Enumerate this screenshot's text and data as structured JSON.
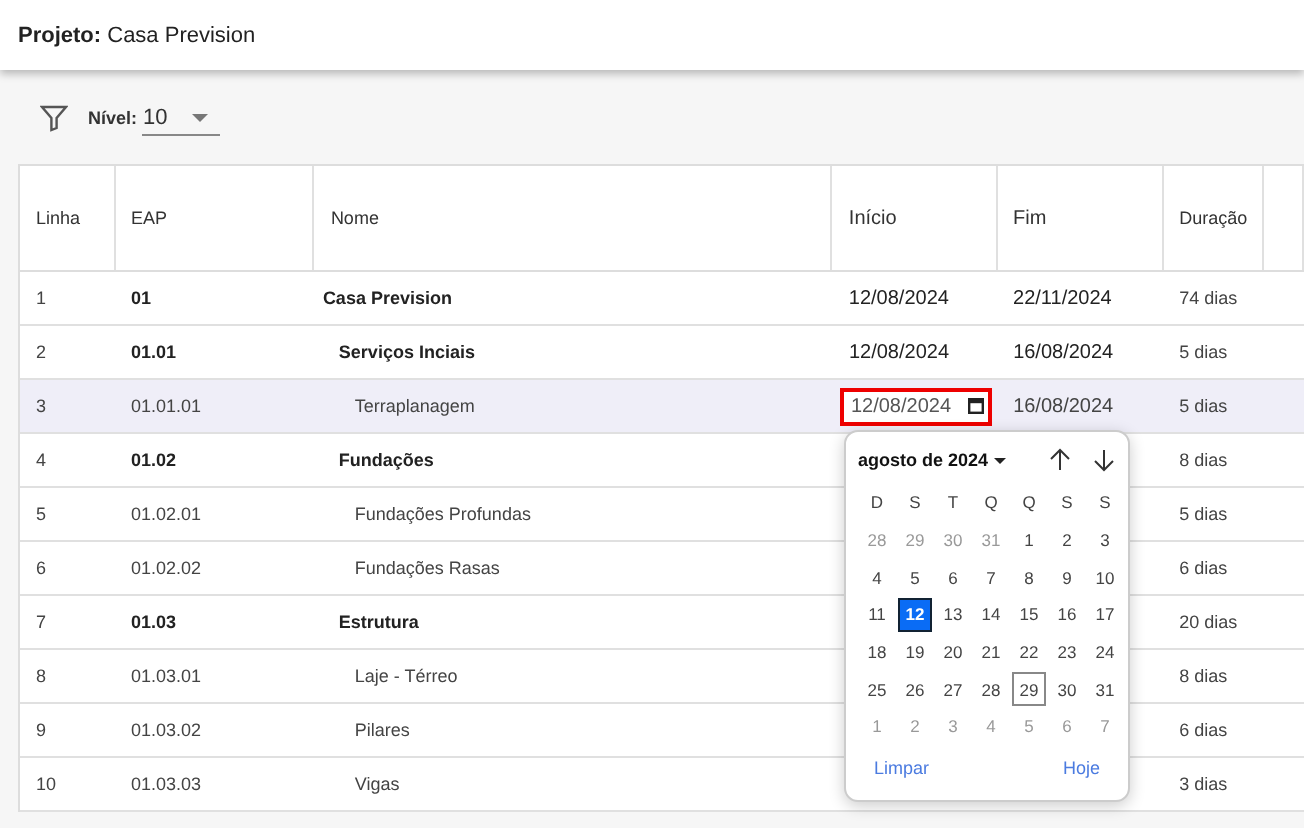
{
  "header": {
    "label": "Projeto:",
    "value": "Casa Prevision"
  },
  "toolbar": {
    "level_label": "Nível:",
    "level_value": "10"
  },
  "table": {
    "columns": [
      "Linha",
      "EAP",
      "Nome",
      "Início",
      "Fim",
      "Duração"
    ],
    "rows": [
      {
        "line": "1",
        "eap": "01",
        "name": "Casa Prevision",
        "start": "12/08/2024",
        "end": "22/11/2024",
        "duration": "74 dias",
        "selected": false,
        "editing": false,
        "children": [
          {
            "line": "2",
            "eap": "01.01",
            "name": "Serviços Inciais",
            "start": "12/08/2024",
            "end": "16/08/2024",
            "duration": "5 dias",
            "selected": false,
            "editing": false,
            "children": [
              {
                "line": "3",
                "eap": "01.01.01",
                "name": "Terraplanagem",
                "start": "12/08/2024",
                "end": "16/08/2024",
                "duration": "5 dias",
                "selected": true,
                "editing": true
              }
            ]
          },
          {
            "line": "4",
            "eap": "01.02",
            "name": "Fundações",
            "duration": "8 dias",
            "selected": false,
            "editing": false,
            "children": [
              {
                "line": "5",
                "eap": "01.02.01",
                "name": "Fundações Profundas",
                "duration": "5 dias",
                "selected": false,
                "editing": false
              },
              {
                "line": "6",
                "eap": "01.02.02",
                "name": "Fundações Rasas",
                "duration": "6 dias",
                "selected": false,
                "editing": false
              }
            ]
          },
          {
            "line": "7",
            "eap": "01.03",
            "name": "Estrutura",
            "duration": "20 dias",
            "selected": false,
            "editing": false,
            "children": [
              {
                "line": "8",
                "eap": "01.03.01",
                "name": "Laje - Térreo",
                "duration": "8 dias",
                "selected": false,
                "editing": false
              },
              {
                "line": "9",
                "eap": "01.03.02",
                "name": "Pilares",
                "duration": "6 dias",
                "selected": false,
                "editing": false
              },
              {
                "line": "10",
                "eap": "01.03.03",
                "name": "Vigas",
                "duration": "3 dias",
                "selected": false,
                "editing": false
              }
            ]
          }
        ]
      }
    ]
  },
  "calendar": {
    "month": "agosto de 2024",
    "weekdays": [
      "D",
      "S",
      "T",
      "Q",
      "Q",
      "S",
      "S"
    ],
    "days": [
      {
        "label": "28",
        "in_month": false,
        "selected": false,
        "today": false
      },
      {
        "label": "29",
        "in_month": false,
        "selected": false,
        "today": false
      },
      {
        "label": "30",
        "in_month": false,
        "selected": false,
        "today": false
      },
      {
        "label": "31",
        "in_month": false,
        "selected": false,
        "today": false
      },
      {
        "label": "1",
        "in_month": true,
        "selected": false,
        "today": false
      },
      {
        "label": "2",
        "in_month": true,
        "selected": false,
        "today": false
      },
      {
        "label": "3",
        "in_month": true,
        "selected": false,
        "today": false
      },
      {
        "label": "4",
        "in_month": true,
        "selected": false,
        "today": false
      },
      {
        "label": "5",
        "in_month": true,
        "selected": false,
        "today": false
      },
      {
        "label": "6",
        "in_month": true,
        "selected": false,
        "today": false
      },
      {
        "label": "7",
        "in_month": true,
        "selected": false,
        "today": false
      },
      {
        "label": "8",
        "in_month": true,
        "selected": false,
        "today": false
      },
      {
        "label": "9",
        "in_month": true,
        "selected": false,
        "today": false
      },
      {
        "label": "10",
        "in_month": true,
        "selected": false,
        "today": false
      },
      {
        "label": "11",
        "in_month": true,
        "selected": false,
        "today": false
      },
      {
        "label": "12",
        "in_month": true,
        "selected": true,
        "today": false
      },
      {
        "label": "13",
        "in_month": true,
        "selected": false,
        "today": false
      },
      {
        "label": "14",
        "in_month": true,
        "selected": false,
        "today": false
      },
      {
        "label": "15",
        "in_month": true,
        "selected": false,
        "today": false
      },
      {
        "label": "16",
        "in_month": true,
        "selected": false,
        "today": false
      },
      {
        "label": "17",
        "in_month": true,
        "selected": false,
        "today": false
      },
      {
        "label": "18",
        "in_month": true,
        "selected": false,
        "today": false
      },
      {
        "label": "19",
        "in_month": true,
        "selected": false,
        "today": false
      },
      {
        "label": "20",
        "in_month": true,
        "selected": false,
        "today": false
      },
      {
        "label": "21",
        "in_month": true,
        "selected": false,
        "today": false
      },
      {
        "label": "22",
        "in_month": true,
        "selected": false,
        "today": false
      },
      {
        "label": "23",
        "in_month": true,
        "selected": false,
        "today": false
      },
      {
        "label": "24",
        "in_month": true,
        "selected": false,
        "today": false
      },
      {
        "label": "25",
        "in_month": true,
        "selected": false,
        "today": false
      },
      {
        "label": "26",
        "in_month": true,
        "selected": false,
        "today": false
      },
      {
        "label": "27",
        "in_month": true,
        "selected": false,
        "today": false
      },
      {
        "label": "28",
        "in_month": true,
        "selected": false,
        "today": false
      },
      {
        "label": "29",
        "in_month": true,
        "selected": false,
        "today": true
      },
      {
        "label": "30",
        "in_month": true,
        "selected": false,
        "today": false
      },
      {
        "label": "31",
        "in_month": true,
        "selected": false,
        "today": false
      },
      {
        "label": "1",
        "in_month": false,
        "selected": false,
        "today": false
      },
      {
        "label": "2",
        "in_month": false,
        "selected": false,
        "today": false
      },
      {
        "label": "3",
        "in_month": false,
        "selected": false,
        "today": false
      },
      {
        "label": "4",
        "in_month": false,
        "selected": false,
        "today": false
      },
      {
        "label": "5",
        "in_month": false,
        "selected": false,
        "today": false
      },
      {
        "label": "6",
        "in_month": false,
        "selected": false,
        "today": false
      },
      {
        "label": "7",
        "in_month": false,
        "selected": false,
        "today": false
      }
    ],
    "clear": "Limpar",
    "today": "Hoje"
  }
}
